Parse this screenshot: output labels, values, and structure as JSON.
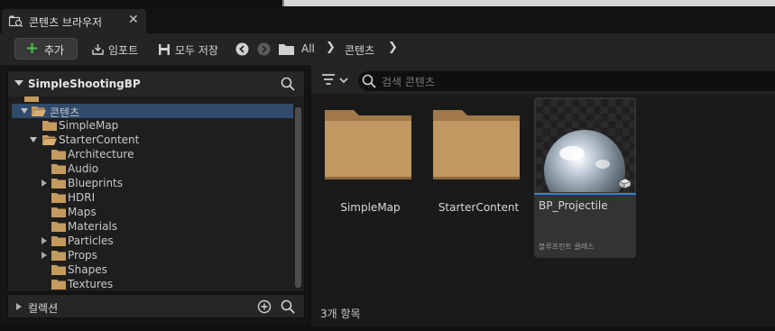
{
  "tab": {
    "title": "콘텐츠 브라우저",
    "close": "✕"
  },
  "toolbar": {
    "add_label": "추가",
    "import_label": "임포트",
    "save_all_label": "모두 저장",
    "breadcrumbs": [
      "All",
      "콘텐츠"
    ]
  },
  "sources": {
    "title": "SimpleShootingBP",
    "tree": [
      {
        "label": "콘텐츠",
        "expanded": true,
        "selected": true
      },
      {
        "label": "SimpleMap"
      },
      {
        "label": "StarterContent",
        "expanded": true
      },
      {
        "label": "Architecture"
      },
      {
        "label": "Audio"
      },
      {
        "label": "Blueprints",
        "has_children": true
      },
      {
        "label": "HDRI"
      },
      {
        "label": "Maps"
      },
      {
        "label": "Materials"
      },
      {
        "label": "Particles",
        "has_children": true
      },
      {
        "label": "Props",
        "has_children": true
      },
      {
        "label": "Shapes"
      },
      {
        "label": "Textures"
      }
    ]
  },
  "collections": {
    "label": "컬렉션"
  },
  "content": {
    "search_placeholder": "검색 콘텐츠",
    "items": [
      {
        "name": "SimpleMap",
        "kind": "folder"
      },
      {
        "name": "StarterContent",
        "kind": "folder"
      },
      {
        "name": "BP_Projectile",
        "kind": "asset",
        "type_label": "블루프린트 클래스"
      }
    ],
    "count_label": "3개 항목"
  },
  "colors": {
    "accent": "#3d7bd6",
    "add_green": "#4cbe4a",
    "folder": "#c49a5f",
    "selection": "#2f4a6b"
  }
}
